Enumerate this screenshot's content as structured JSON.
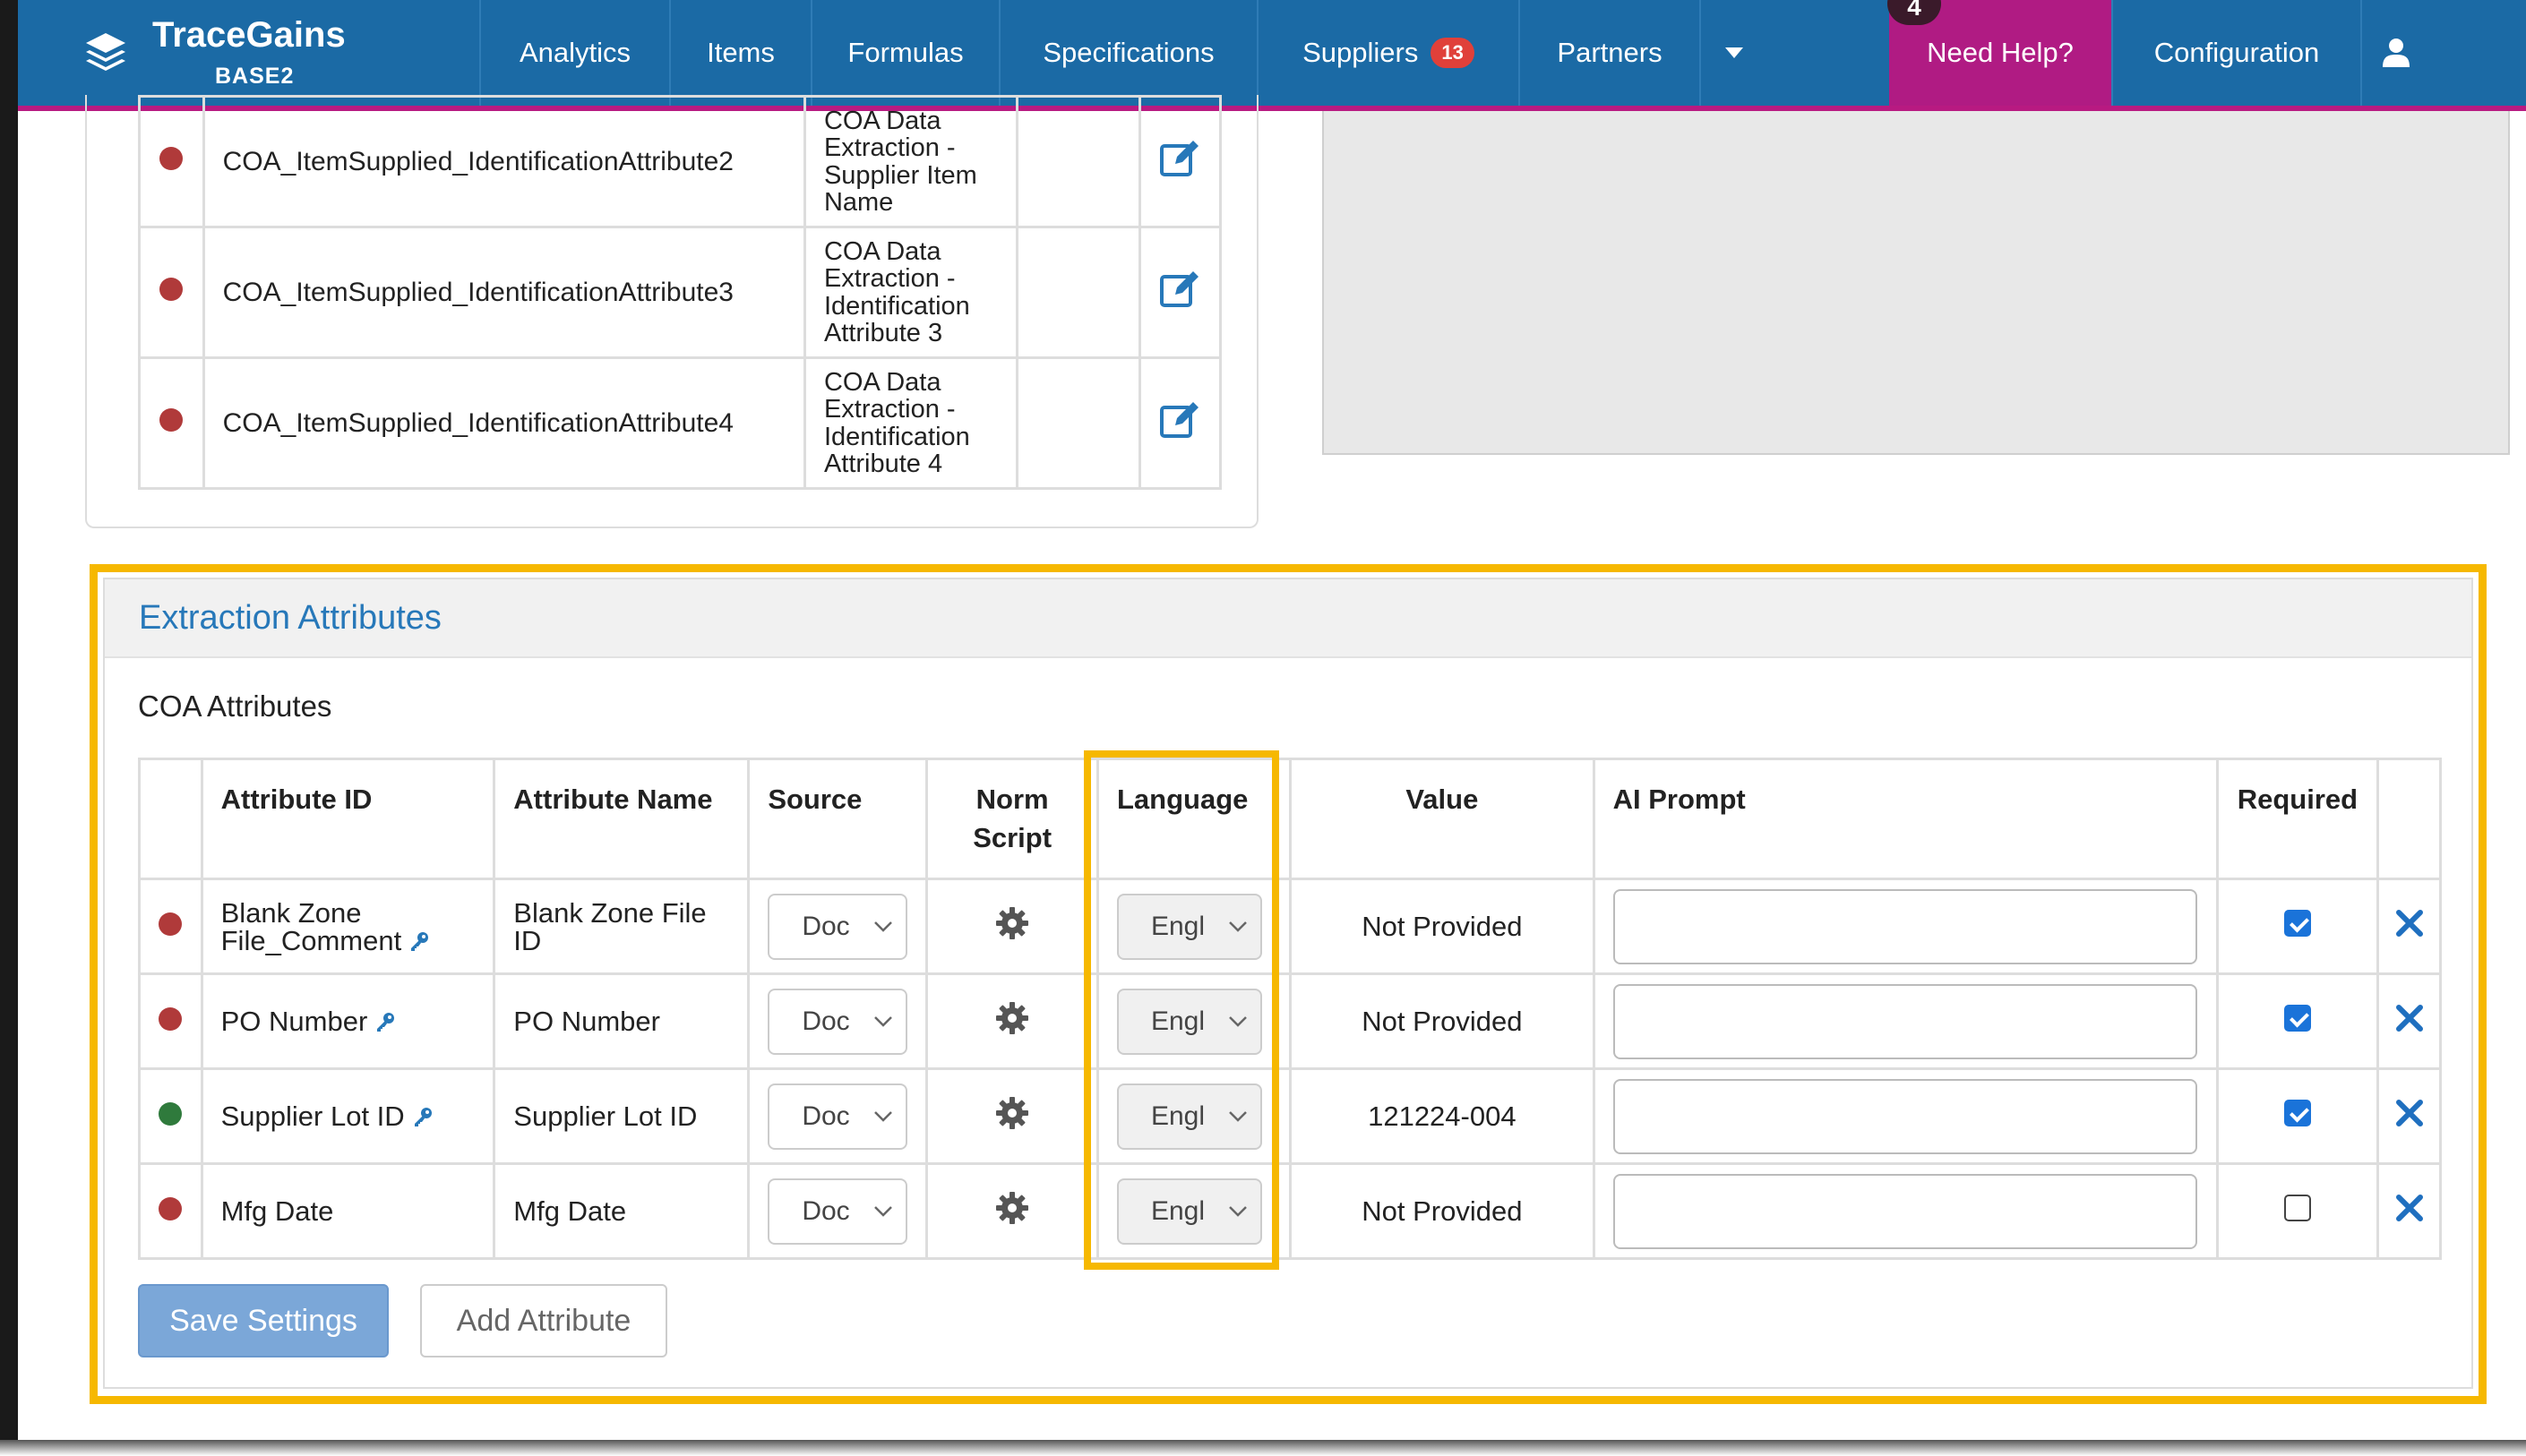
{
  "brand": {
    "title": "TraceGains",
    "subtitle": "BASE2"
  },
  "nav": {
    "items": [
      {
        "label": "Analytics"
      },
      {
        "label": "Items"
      },
      {
        "label": "Formulas"
      },
      {
        "label": "Specifications"
      },
      {
        "label": "Suppliers",
        "badge": "13"
      },
      {
        "label": "Partners"
      }
    ],
    "help_label": "Need Help?",
    "help_count": "4",
    "config_label": "Configuration"
  },
  "upper_table": {
    "rows": [
      {
        "status": "red",
        "id": "COA_ItemSupplied_IdentificationAttribute2",
        "name_lines": [
          "COA Data",
          "Extraction -",
          "Supplier Item",
          "Name"
        ]
      },
      {
        "status": "red",
        "id": "COA_ItemSupplied_IdentificationAttribute3",
        "name_lines": [
          "COA Data",
          "Extraction -",
          "Identification",
          "Attribute 3"
        ]
      },
      {
        "status": "red",
        "id": "COA_ItemSupplied_IdentificationAttribute4",
        "name_lines": [
          "COA Data",
          "Extraction -",
          "Identification",
          "Attribute 4"
        ]
      }
    ]
  },
  "extraction": {
    "section_title": "Extraction Attributes",
    "subsection_title": "COA Attributes",
    "headers": {
      "attribute_id": "Attribute ID",
      "attribute_name": "Attribute Name",
      "source": "Source",
      "norm_script_1": "Norm",
      "norm_script_2": "Script",
      "language": "Language",
      "value": "Value",
      "ai_prompt": "AI Prompt",
      "required": "Required"
    },
    "rows": [
      {
        "status": "red",
        "id_lines": [
          "Blank Zone",
          "File_Comment"
        ],
        "has_key": true,
        "name_lines": [
          "Blank Zone File",
          "ID"
        ],
        "source": "Doc",
        "language": "Engl",
        "value": "Not Provided",
        "ai_prompt": "",
        "required": true
      },
      {
        "status": "red",
        "id_lines": [
          "PO Number"
        ],
        "has_key": true,
        "name_lines": [
          "PO Number"
        ],
        "source": "Doc",
        "language": "Engl",
        "value": "Not Provided",
        "ai_prompt": "",
        "required": true
      },
      {
        "status": "green",
        "id_lines": [
          "Supplier Lot ID"
        ],
        "has_key": true,
        "name_lines": [
          "Supplier Lot ID"
        ],
        "source": "Doc",
        "language": "Engl",
        "value": "121224-004",
        "ai_prompt": "",
        "required": true
      },
      {
        "status": "red",
        "id_lines": [
          "Mfg Date"
        ],
        "has_key": false,
        "name_lines": [
          "Mfg Date"
        ],
        "source": "Doc",
        "language": "Engl",
        "value": "Not Provided",
        "ai_prompt": "",
        "required": false
      }
    ],
    "save_label": "Save Settings",
    "add_label": "Add Attribute"
  },
  "colors": {
    "nav_bg": "#1b6aa5",
    "help_bg": "#b01b83",
    "accent": "#2778b9",
    "status_red": "#b03a3a",
    "status_green": "#2f7a3c",
    "highlight": "#f6b800"
  },
  "icons": {
    "logo": "stacked-layers-icon",
    "caret": "caret-down-icon",
    "user": "user-icon",
    "edit": "edit-icon",
    "key": "key-icon",
    "gear": "gear-icon",
    "remove": "close-icon"
  }
}
